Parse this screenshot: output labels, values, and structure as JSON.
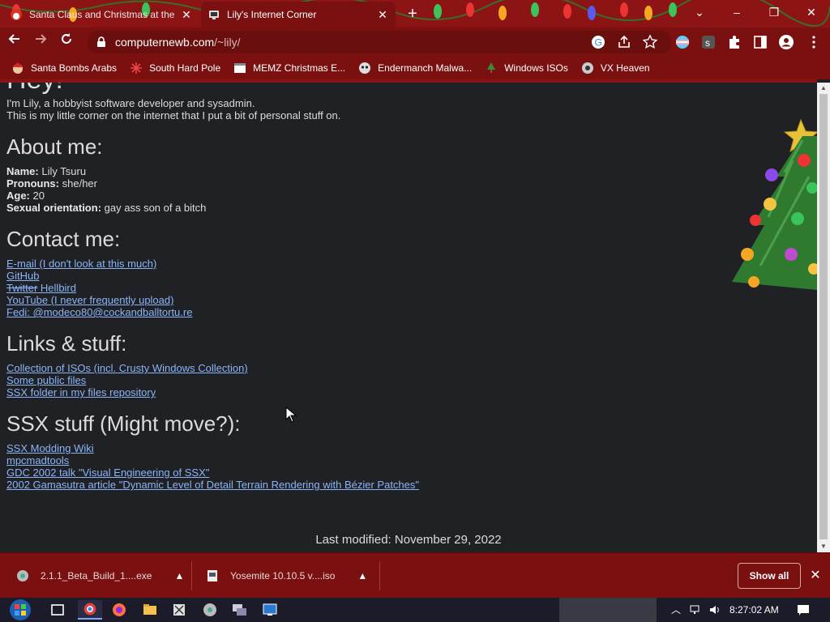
{
  "tabs": [
    {
      "title": "Santa Claus and Christmas at the",
      "active": false
    },
    {
      "title": "Lily's Internet Corner",
      "active": true
    }
  ],
  "window": {
    "minimize": "–",
    "maximize": "❐",
    "close": "✕",
    "tablist": "⌄"
  },
  "toolbar": {
    "url_host": "computernewb.com",
    "url_path": "/~lily/"
  },
  "bookmarks": [
    {
      "label": "Santa Bombs Arabs",
      "icon": "santa-icon"
    },
    {
      "label": "South Hard Pole",
      "icon": "snowflake-icon"
    },
    {
      "label": "MEMZ Christmas E...",
      "icon": "window-icon"
    },
    {
      "label": "Endermanch Malwa...",
      "icon": "mask-icon"
    },
    {
      "label": "Windows ISOs",
      "icon": "tree-icon"
    },
    {
      "label": "VX Heaven",
      "icon": "biohazard-icon"
    }
  ],
  "page": {
    "heading": "Hey!",
    "intro1": "I'm Lily, a hobbyist software developer and sysadmin.",
    "intro2": "This is my little corner on the internet that I put a bit of personal stuff on.",
    "about_title": "About me:",
    "about": [
      {
        "label": "Name:",
        "value": "Lily Tsuru"
      },
      {
        "label": "Pronouns:",
        "value": "she/her"
      },
      {
        "label": "Age:",
        "value": "20"
      },
      {
        "label": "Sexual orientation:",
        "value": "gay ass son of a bitch"
      }
    ],
    "contact_title": "Contact me:",
    "contact": {
      "email": "E-mail (I don't look at this much)",
      "github": "GitHub",
      "twitter_strike": "Twitter",
      "twitter_new": "Hellbird",
      "youtube": "YouTube (I never frequently upload)",
      "fedi": "Fedi: @modeco80@cockandballtortu.re"
    },
    "links_title": "Links & stuff:",
    "links": [
      "Collection of ISOs (incl. Crusty Windows Collection)",
      "Some public files",
      "SSX folder in my files repository"
    ],
    "ssx_title": "SSX stuff (Might move?):",
    "ssx": [
      "SSX Modding Wiki",
      "mpcmadtools",
      "GDC 2002 talk \"Visual Engineering of SSX\"",
      "2002 Gamasutra article \"Dynamic Level of Detail Terrain Rendering with Bézier Patches\""
    ],
    "last_modified": "Last modified: November 29, 2022"
  },
  "downloads": [
    {
      "name": "2.1.1_Beta_Build_1....exe"
    },
    {
      "name": "Yosemite 10.10.5 v....iso"
    }
  ],
  "shelf": {
    "show_all": "Show all",
    "close": "✕"
  },
  "taskbar": {
    "time": "8:27:02 AM"
  }
}
